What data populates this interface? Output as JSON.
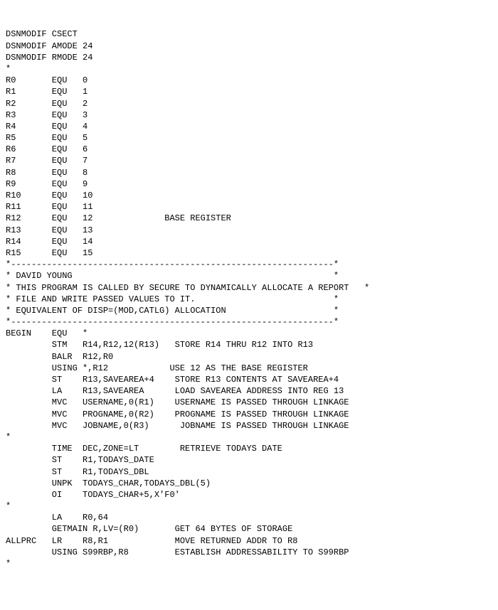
{
  "lines": [
    "DSNMODIF CSECT",
    "DSNMODIF AMODE 24",
    "DSNMODIF RMODE 24",
    "*",
    "R0       EQU   0",
    "R1       EQU   1",
    "R2       EQU   2",
    "R3       EQU   3",
    "R4       EQU   4",
    "R5       EQU   5",
    "R6       EQU   6",
    "R7       EQU   7",
    "R8       EQU   8",
    "R9       EQU   9",
    "R10      EQU   10",
    "R11      EQU   11",
    "R12      EQU   12              BASE REGISTER",
    "R13      EQU   13",
    "R14      EQU   14",
    "R15      EQU   15",
    "*---------------------------------------------------------------*",
    "* DAVID YOUNG                                                   *",
    "* THIS PROGRAM IS CALLED BY SECURE TO DYNAMICALLY ALLOCATE A REPORT   *",
    "* FILE AND WRITE PASSED VALUES TO IT.                           *",
    "* EQUIVALENT OF DISP=(MOD,CATLG) ALLOCATION                     *",
    "*---------------------------------------------------------------*",
    "BEGIN    EQU   *",
    "         STM   R14,R12,12(R13)   STORE R14 THRU R12 INTO R13",
    "         BALR  R12,R0",
    "         USING *,R12            USE 12 AS THE BASE REGISTER",
    "         ST    R13,SAVEAREA+4    STORE R13 CONTENTS AT SAVEAREA+4",
    "         LA    R13,SAVEAREA      LOAD SAVEAREA ADDRESS INTO REG 13",
    "         MVC   USERNAME,0(R1)    USERNAME IS PASSED THROUGH LINKAGE",
    "         MVC   PROGNAME,0(R2)    PROGNAME IS PASSED THROUGH LINKAGE",
    "         MVC   JOBNAME,0(R3)      JOBNAME IS PASSED THROUGH LINKAGE",
    "*",
    "         TIME  DEC,ZONE=LT        RETRIEVE TODAYS DATE",
    "         ST    R1,TODAYS_DATE",
    "         ST    R1,TODAYS_DBL",
    "         UNPK  TODAYS_CHAR,TODAYS_DBL(5)",
    "         OI    TODAYS_CHAR+5,X'F0'",
    "*",
    "         LA    R0,64",
    "         GETMAIN R,LV=(R0)       GET 64 BYTES OF STORAGE",
    "ALLPRC   LR    R8,R1             MOVE RETURNED ADDR TO R8",
    "         USING S99RBP,R8         ESTABLISH ADDRESSABILITY TO S99RBP",
    "*"
  ]
}
